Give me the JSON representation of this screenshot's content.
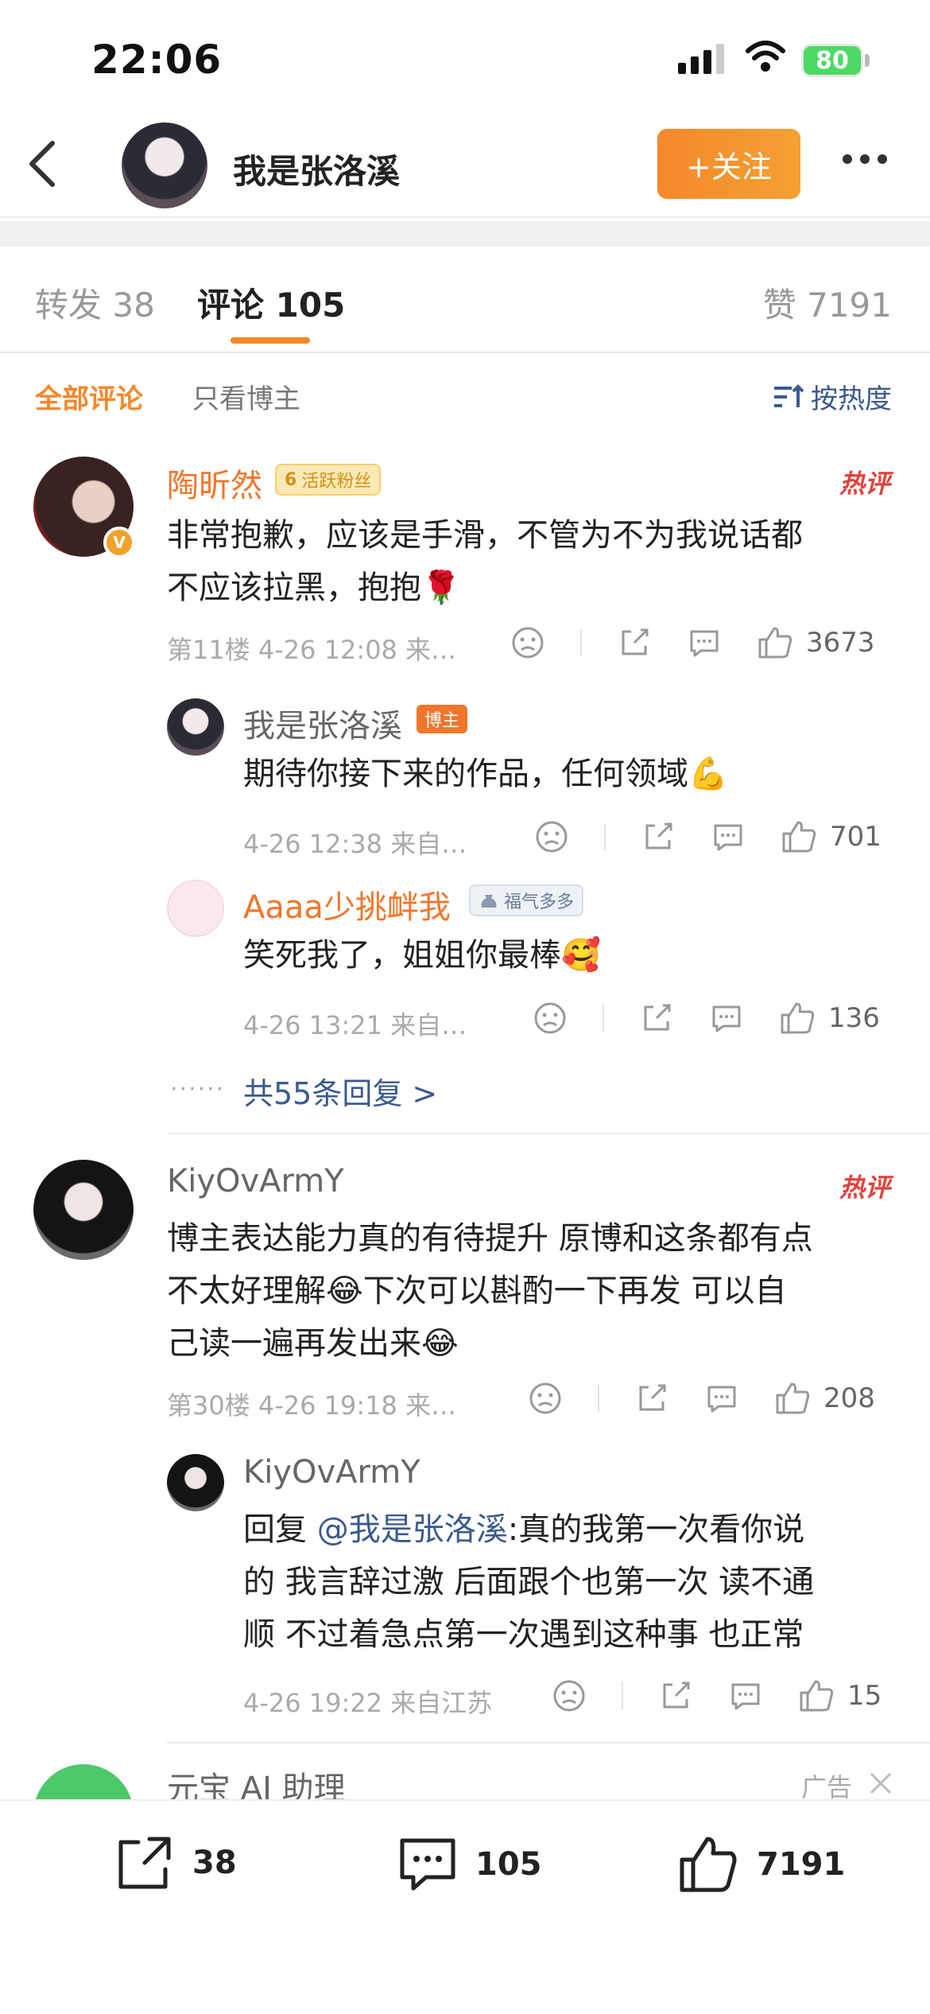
{
  "status_bar": {
    "time": "22:06",
    "battery": "80"
  },
  "header": {
    "title": "我是张洛溪",
    "follow_label": "+关注"
  },
  "tabs": {
    "repost": {
      "label": "转发",
      "count": "38"
    },
    "comment": {
      "label": "评论",
      "count": "105"
    },
    "like": {
      "label": "赞",
      "count": "7191"
    }
  },
  "filters": {
    "all": "全部评论",
    "blogger_only": "只看博主",
    "sort": "按热度"
  },
  "comments": [
    {
      "name": "陶昕然",
      "badge": "活跃粉丝",
      "badge_level": "6",
      "hot": "热评",
      "text_line1": "非常抱歉，应该是手滑，不管为不为我说话都",
      "text_line2": "不应该拉黑，抱抱🌹",
      "meta": "第11楼 4-26 12:08  来…",
      "likes": "3673",
      "replies": [
        {
          "name": "我是张洛溪",
          "badge": "博主",
          "text": "期待你接下来的作品，任何领域💪",
          "meta": "4-26 12:38  来自…",
          "likes": "701"
        },
        {
          "name": "Aaaa少挑衅我",
          "badge": "福气多多",
          "text": "笑死我了，姐姐你最棒🥰",
          "meta": "4-26 13:21  来自…",
          "likes": "136"
        }
      ],
      "more_replies": "共55条回复 >"
    },
    {
      "name": "KiyOvArmY",
      "hot": "热评",
      "text_line1": "博主表达能力真的有待提升 原博和这条都有点",
      "text_line2": "不太好理解😂下次可以斟酌一下再发 可以自",
      "text_line3": "己读一遍再发出来😂",
      "meta": "第30楼 4-26 19:18  来…",
      "likes": "208",
      "reply": {
        "name": "KiyOvArmY",
        "prefix": "回复 ",
        "mention": "@我是张洛溪",
        "line1_rest": ":真的我第一次看你说",
        "line2": "的 我言辞过激 后面跟个也第一次 读不通",
        "line3": "顺 不过着急点第一次遇到这种事 也正常",
        "meta": "4-26 19:22  来自江苏",
        "likes": "15"
      }
    }
  ],
  "ad": {
    "name": "元宝 AI 助理",
    "label": "广告"
  },
  "bottom_bar": {
    "repost": "38",
    "comment": "105",
    "like": "7191"
  }
}
